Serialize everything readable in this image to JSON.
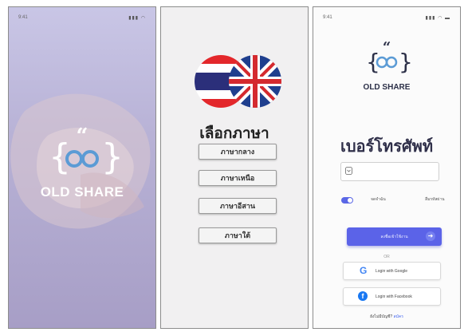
{
  "status": {
    "time": "9:41",
    "signal": "…••"
  },
  "brand": {
    "name": "OLD SHARE",
    "logo_quote": "“"
  },
  "language_screen": {
    "heading": "เลือกภาษา",
    "options": [
      "ภาษากลาง",
      "ภาษาเหนือ",
      "ภาษาอีสาน",
      "ภาษาใต้"
    ]
  },
  "login_screen": {
    "heading": "เบอร์โทรศัพท์",
    "phone_placeholder": "",
    "remember_label": "จดจำฉัน",
    "forgot_label": "ลืมรหัสผ่าน",
    "submit_label": "ลงชื่อเข้าใช้งาน",
    "or_label": "OR",
    "google_label": "Login with Google",
    "facebook_label": "Login with Facebook",
    "no_account_label": "ยังไม่มีบัญชี?",
    "signup_label": "สมัคร"
  },
  "colors": {
    "accent": "#5b63e8",
    "logo_blue": "#5b9bd5",
    "text_dark": "#2f2f49"
  }
}
